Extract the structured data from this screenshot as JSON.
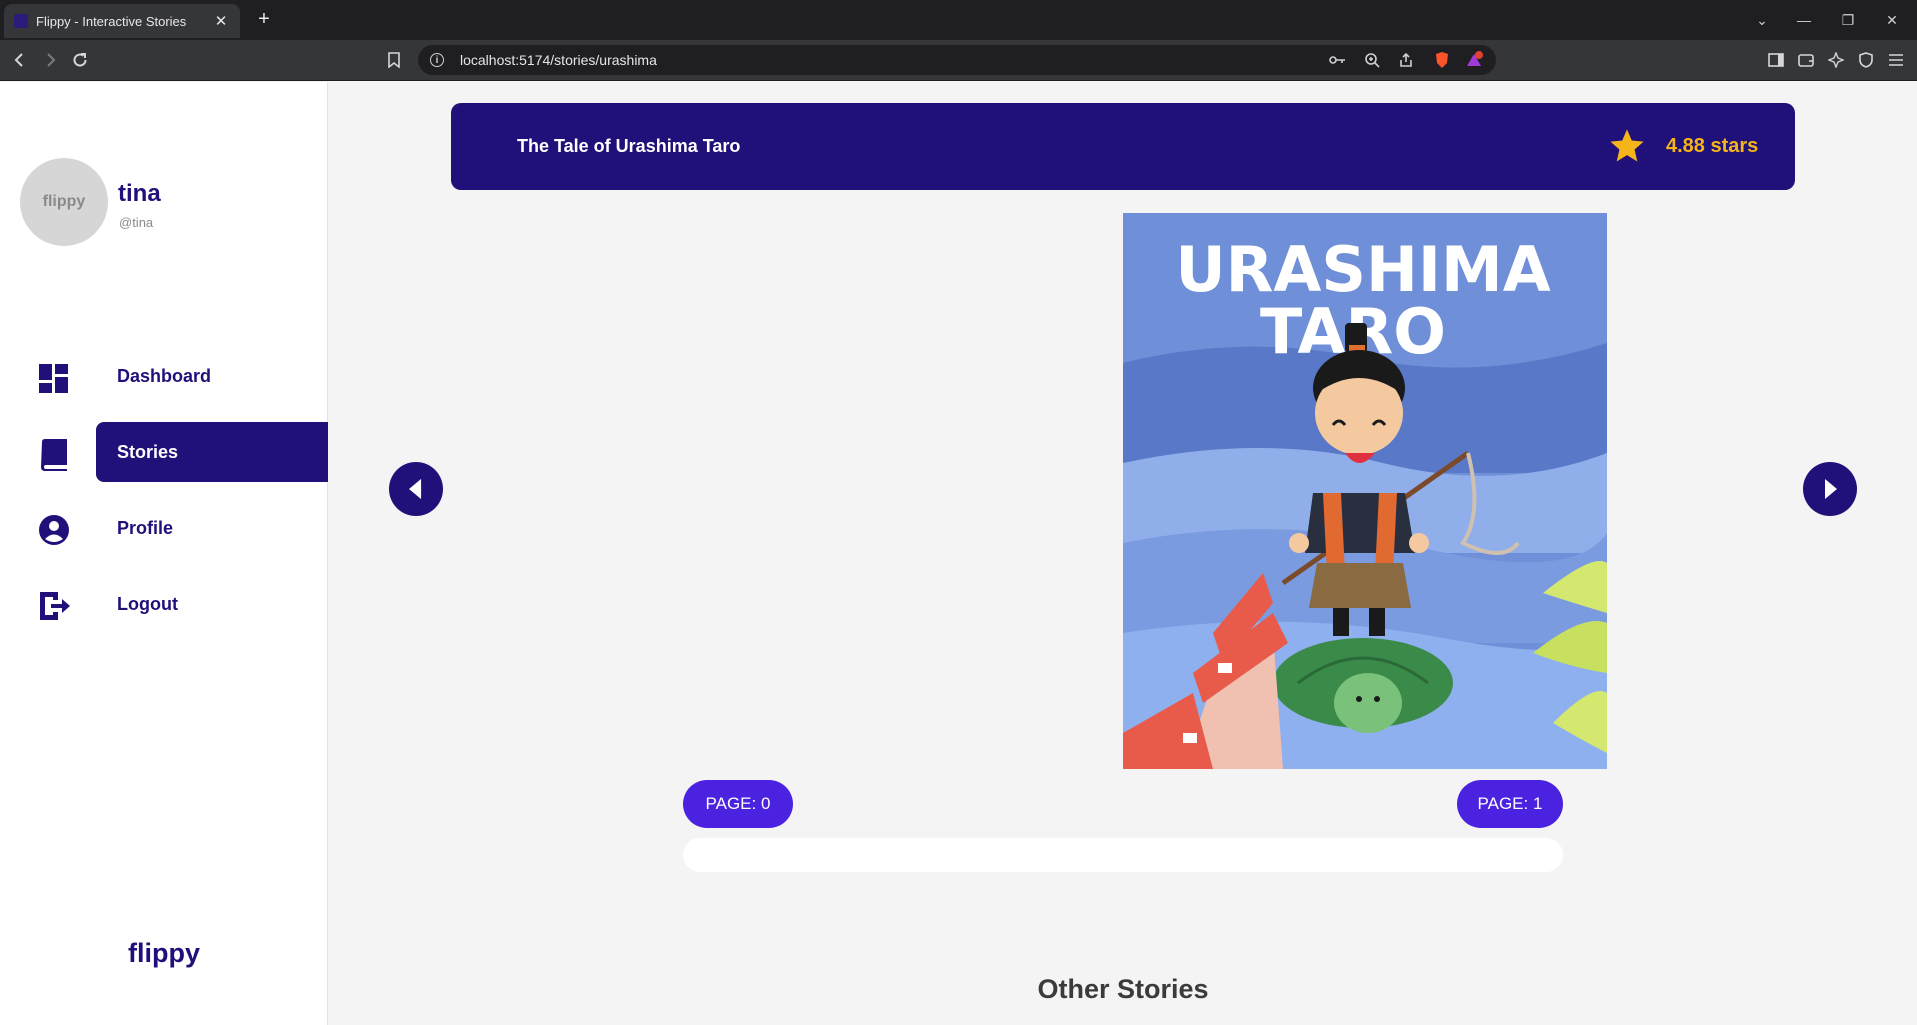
{
  "browser": {
    "tab_title": "Flippy - Interactive Stories",
    "tab_close": "✕",
    "new_tab": "+",
    "url": "localhost:5174/stories/urashima",
    "window_controls": {
      "minimize": "—",
      "maximize": "❐",
      "close": "✕",
      "dropdown": "⌄"
    }
  },
  "user": {
    "avatar_text": "flippy",
    "name": "tina",
    "handle": "@tina"
  },
  "nav": {
    "items": [
      {
        "label": "Dashboard",
        "icon": "dashboard-icon",
        "active": false
      },
      {
        "label": "Stories",
        "icon": "book-icon",
        "active": true
      },
      {
        "label": "Profile",
        "icon": "account-circle-icon",
        "active": false
      },
      {
        "label": "Logout",
        "icon": "logout-icon",
        "active": false
      }
    ]
  },
  "brand": "flippy",
  "story": {
    "title": "The Tale of Urashima Taro",
    "rating": "4.88 stars",
    "cover_title_line1": "URASHIMA",
    "cover_title_line2": "TARO"
  },
  "pagination": {
    "left_page": "PAGE: 0",
    "right_page": "PAGE: 1"
  },
  "other_stories_heading": "Other Stories",
  "colors": {
    "primary": "#20107a",
    "accent_button": "#4a22e0",
    "star": "#f4b41a"
  }
}
